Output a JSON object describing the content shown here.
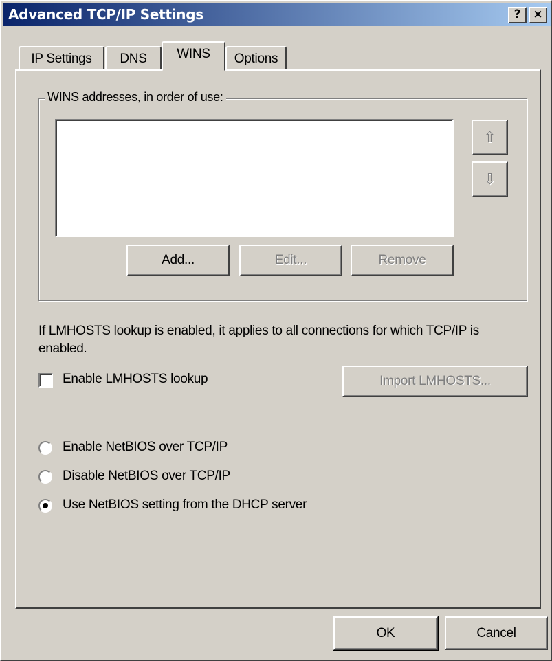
{
  "window": {
    "title": "Advanced TCP/IP Settings",
    "help_glyph": "?",
    "close_glyph": "×"
  },
  "tabs": [
    {
      "label": "IP Settings",
      "active": false
    },
    {
      "label": "DNS",
      "active": false
    },
    {
      "label": "WINS",
      "active": true
    },
    {
      "label": "Options",
      "active": false
    }
  ],
  "wins": {
    "group_label": "WINS addresses, in order of use:",
    "addresses": [],
    "up_glyph": "⇧",
    "down_glyph": "⇩",
    "buttons": {
      "add": "Add...",
      "edit": "Edit...",
      "remove": "Remove"
    }
  },
  "lmhosts": {
    "info": "If LMHOSTS lookup is enabled, it applies to all connections for which TCP/IP is enabled.",
    "checkbox_label": "Enable LMHOSTS lookup",
    "checked": false,
    "import_label": "Import LMHOSTS..."
  },
  "netbios": {
    "options": [
      {
        "label": "Enable NetBIOS over TCP/IP",
        "selected": false
      },
      {
        "label": "Disable NetBIOS over TCP/IP",
        "selected": false
      },
      {
        "label": "Use NetBIOS setting from the DHCP server",
        "selected": true
      }
    ]
  },
  "footer": {
    "ok": "OK",
    "cancel": "Cancel"
  }
}
